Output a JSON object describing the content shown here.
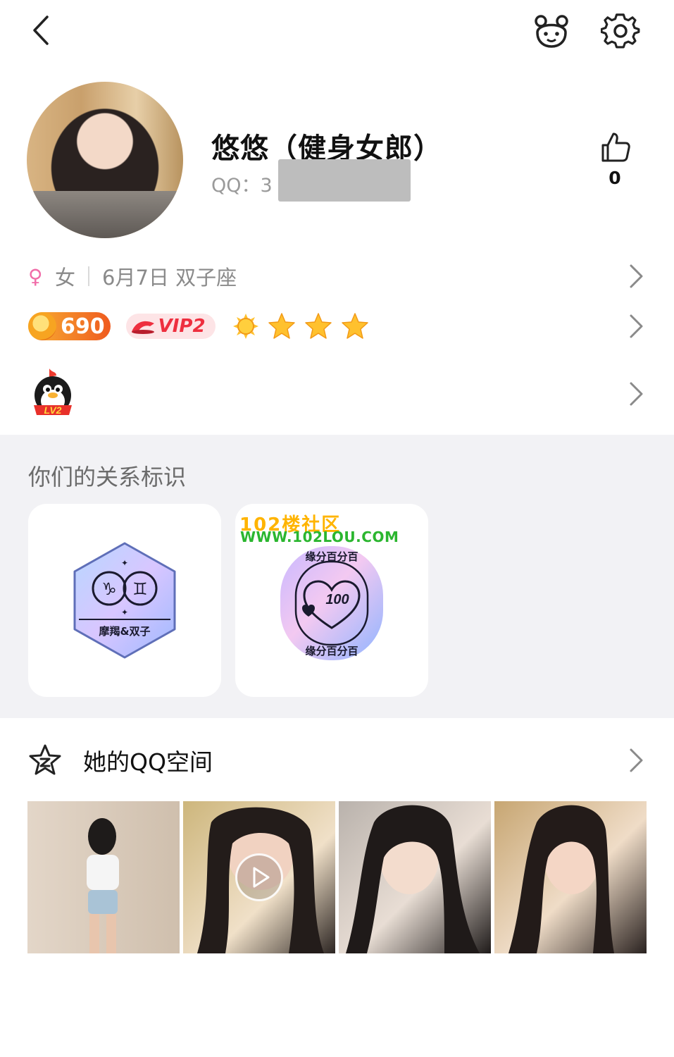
{
  "header": {
    "back_icon": "chevron-left-icon",
    "pet_icon": "pet-bear-icon",
    "settings_icon": "gear-icon"
  },
  "profile": {
    "nickname": "悠悠（健身女郎）",
    "qq_label": "QQ：3",
    "likes_count": "0"
  },
  "info": {
    "gender_symbol": "♀",
    "gender": "女",
    "birthday": "6月7日 双子座"
  },
  "badges": {
    "coins": "690",
    "vip": "VIP2",
    "level_sun": 1,
    "level_stars": 3,
    "qq_level": "LV2"
  },
  "relationship": {
    "section_title": "你们的关系标识",
    "card1_label": "摩羯&双子",
    "card2_top_text": "缘分百分百",
    "card2_bottom_text": "缘分百分百",
    "card2_score": "100"
  },
  "watermark": {
    "line1": "102楼社区",
    "line2": "WWW.102LOU.COM"
  },
  "space": {
    "title": "她的QQ空间",
    "photo_count": 4,
    "video_index": 2
  },
  "colors": {
    "accent_vip": "#ee2f3f",
    "gender_pink": "#f06ca8",
    "section_bg": "#f2f2f5",
    "star_gold": "#ffc12e"
  }
}
